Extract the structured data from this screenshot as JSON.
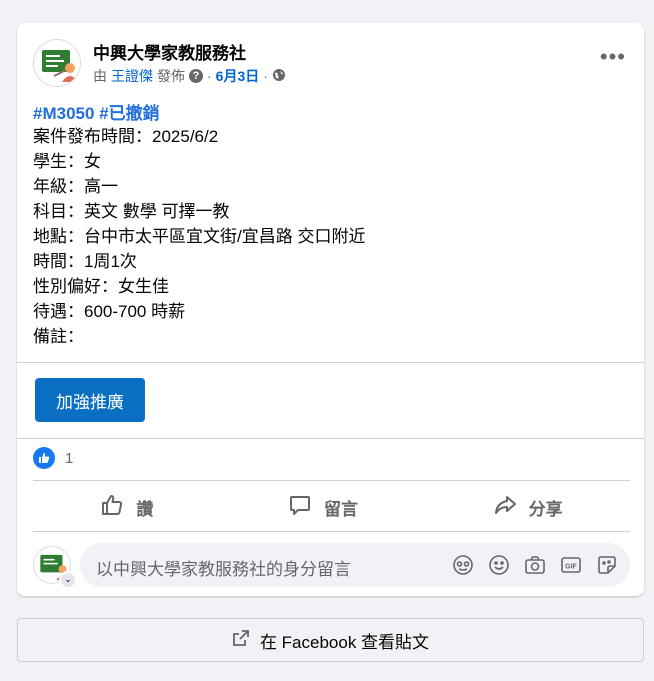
{
  "post": {
    "page_name": "中興大學家教服務社",
    "meta": {
      "by": "由",
      "author": "王證傑",
      "posted": "發佈",
      "sep1": "·",
      "date": "6月3日",
      "sep2": "·"
    },
    "hashtags": "#M3050 #已撤銷",
    "body": [
      "案件發布時間：2025/6/2",
      "學生：女",
      "年級：高一",
      "科目：英文 數學  可擇一教",
      "地點：台中市太平區宜文街/宜昌路 交口附近",
      "時間：1周1次",
      "性別偏好：女生佳",
      "待遇：600-700 時薪",
      "備註："
    ],
    "boost_label": "加強推廣",
    "reaction_count": "1",
    "actions": {
      "like": "讚",
      "comment": "留言",
      "share": "分享"
    },
    "comment_placeholder": "以中興大學家教服務社的身分留言",
    "view_on_facebook": "在 Facebook 查看貼文"
  },
  "colors": {
    "brand_blue": "#1877f2",
    "boost_blue": "#0a6fc2",
    "link_blue": "#216fdb"
  }
}
